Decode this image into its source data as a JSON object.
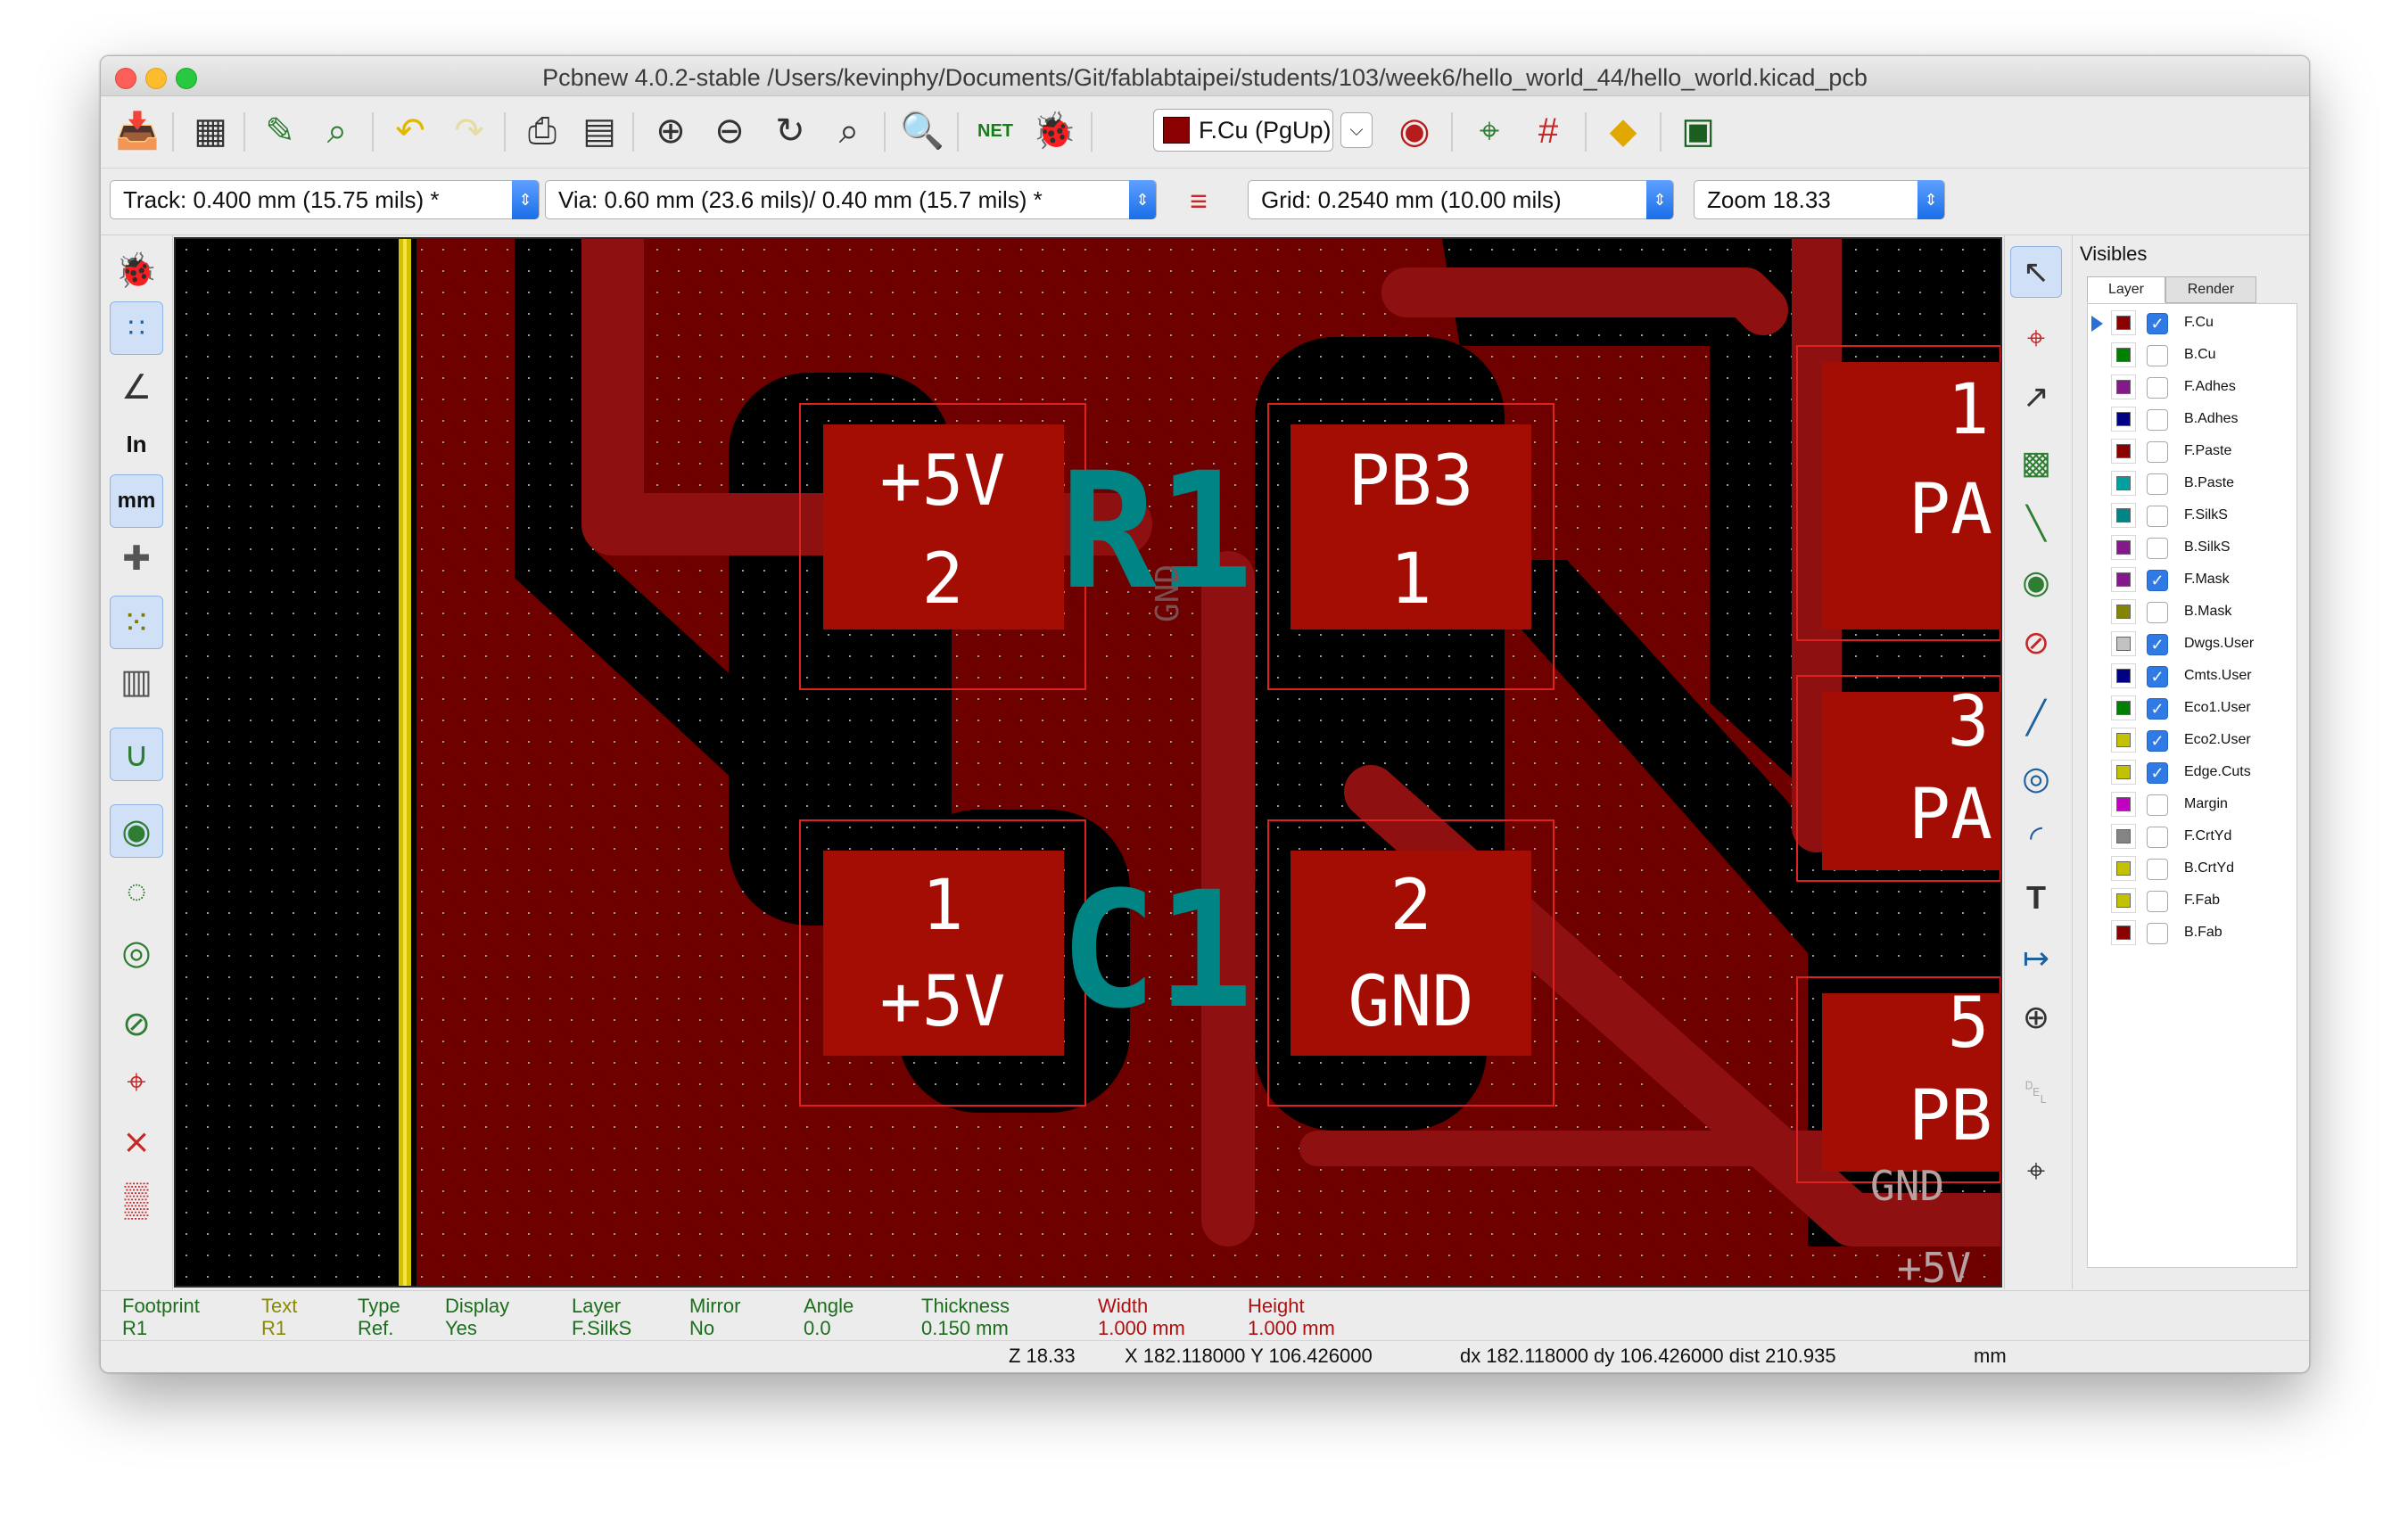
{
  "window": {
    "title": "Pcbnew 4.0.2-stable /Users/kevinphy/Documents/Git/fablabtaipei/students/103/week6/hello_world_44/hello_world.kicad_pcb"
  },
  "toolbar": {
    "active_layer": "F.Cu (PgUp)",
    "net_label": "NET"
  },
  "toolbar2": {
    "track": "Track: 0.400 mm (15.75 mils) *",
    "via": "Via: 0.60 mm (23.6 mils)/ 0.40 mm (15.7 mils) *",
    "grid": "Grid: 0.2540 mm (10.00 mils)",
    "zoom": "Zoom 18.33"
  },
  "left_toolbar": {
    "units_in": "In",
    "units_mm": "mm"
  },
  "canvas": {
    "pads": [
      {
        "line1": "+5V",
        "line2": "2"
      },
      {
        "line1": "PB3",
        "line2": "1"
      },
      {
        "line1": "1",
        "line2": "+5V"
      },
      {
        "line1": "2",
        "line2": "GND"
      },
      {
        "line1": "1",
        "line2": "PA"
      },
      {
        "line1": "3",
        "line2": "PA"
      },
      {
        "line1": "5",
        "line2": "PB"
      }
    ],
    "ref_r1": "R1",
    "ref_c1": "C1",
    "label_gnd_vertical": "GND",
    "label_gnd": "GND",
    "label_5v": "+5V"
  },
  "panel": {
    "title": "Visibles",
    "tabs": [
      "Layer",
      "Render"
    ],
    "layers": [
      {
        "name": "F.Cu",
        "color": "#8b0000",
        "checked": true,
        "active": true
      },
      {
        "name": "B.Cu",
        "color": "#008000",
        "checked": false,
        "active": false
      },
      {
        "name": "F.Adhes",
        "color": "#84198c",
        "checked": false,
        "active": false
      },
      {
        "name": "B.Adhes",
        "color": "#000084",
        "checked": false,
        "active": false
      },
      {
        "name": "F.Paste",
        "color": "#8b0000",
        "checked": false,
        "active": false
      },
      {
        "name": "B.Paste",
        "color": "#00a0a0",
        "checked": false,
        "active": false
      },
      {
        "name": "F.SilkS",
        "color": "#008484",
        "checked": false,
        "active": false
      },
      {
        "name": "B.SilkS",
        "color": "#84198c",
        "checked": false,
        "active": false
      },
      {
        "name": "F.Mask",
        "color": "#84198c",
        "checked": true,
        "active": false
      },
      {
        "name": "B.Mask",
        "color": "#848400",
        "checked": false,
        "active": false
      },
      {
        "name": "Dwgs.User",
        "color": "#c2c2c2",
        "checked": true,
        "active": false
      },
      {
        "name": "Cmts.User",
        "color": "#000084",
        "checked": true,
        "active": false
      },
      {
        "name": "Eco1.User",
        "color": "#008000",
        "checked": true,
        "active": false
      },
      {
        "name": "Eco2.User",
        "color": "#c2c200",
        "checked": true,
        "active": false
      },
      {
        "name": "Edge.Cuts",
        "color": "#c2c200",
        "checked": true,
        "active": false
      },
      {
        "name": "Margin",
        "color": "#c200c2",
        "checked": false,
        "active": false
      },
      {
        "name": "F.CrtYd",
        "color": "#848484",
        "checked": false,
        "active": false
      },
      {
        "name": "B.CrtYd",
        "color": "#c2c200",
        "checked": false,
        "active": false
      },
      {
        "name": "F.Fab",
        "color": "#c2c200",
        "checked": false,
        "active": false
      },
      {
        "name": "B.Fab",
        "color": "#8b0000",
        "checked": false,
        "active": false
      }
    ]
  },
  "msgpanel": [
    {
      "label": "Footprint",
      "value": "R1",
      "color": "#1b6e1b"
    },
    {
      "label": "Text",
      "value": "R1",
      "color": "#8a8a00"
    },
    {
      "label": "Type",
      "value": "Ref.",
      "color": "#1b6e1b"
    },
    {
      "label": "Display",
      "value": "Yes",
      "color": "#1b6e1b"
    },
    {
      "label": "Layer",
      "value": "F.SilkS",
      "color": "#1b6e1b"
    },
    {
      "label": "Mirror",
      "value": "No",
      "color": "#1b6e1b"
    },
    {
      "label": "Angle",
      "value": "0.0",
      "color": "#1b6e1b"
    },
    {
      "label": "Thickness",
      "value": "0.150 mm",
      "color": "#1b6e1b"
    },
    {
      "label": "Width",
      "value": "1.000 mm",
      "color": "#b01010"
    },
    {
      "label": "Height",
      "value": "1.000 mm",
      "color": "#b01010"
    }
  ],
  "status": {
    "zoom": "Z 18.33",
    "xy": "X 182.118000  Y 106.426000",
    "dxy": "dx 182.118000  dy 106.426000  dist 210.935",
    "units": "mm"
  },
  "colors": {
    "copper": "#8b0000",
    "copper_pad": "#a30d04",
    "silk": "#008484",
    "edge": "#d4c200"
  }
}
